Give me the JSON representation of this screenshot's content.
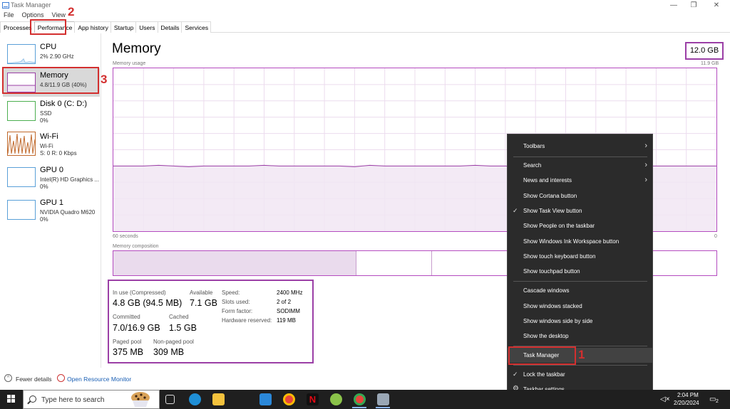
{
  "window": {
    "title": "Task Manager",
    "controls": {
      "minimize": "—",
      "restore": "❐",
      "close": "✕"
    }
  },
  "menu": [
    "File",
    "Options",
    "View"
  ],
  "tabs": [
    "Processes",
    "Performance",
    "App history",
    "Startup",
    "Users",
    "Details",
    "Services"
  ],
  "sidebar": {
    "items": [
      {
        "title": "CPU",
        "line1": "2% 2.90 GHz",
        "line2": "",
        "color": "#5aa0d8"
      },
      {
        "title": "Memory",
        "line1": "4.8/11.9 GB (40%)",
        "line2": "",
        "color": "#9b3fa6"
      },
      {
        "title": "Disk 0 (C: D:)",
        "line1": "SSD",
        "line2": "0%",
        "color": "#4caf50"
      },
      {
        "title": "Wi-Fi",
        "line1": "Wi-Fi",
        "line2": "S: 0 R: 0 Kbps",
        "color": "#c0692c"
      },
      {
        "title": "GPU 0",
        "line1": "Intel(R) HD Graphics ...",
        "line2": "0%",
        "color": "#5aa0d8"
      },
      {
        "title": "GPU 1",
        "line1": "NVIDIA Quadro M620",
        "line2": "0%",
        "color": "#5aa0d8"
      }
    ]
  },
  "main": {
    "title": "Memory",
    "total": "12.0 GB",
    "usage_label": "Memory usage",
    "usage_max": "11.9 GB",
    "time_label": "60 seconds",
    "time_end": "0",
    "composition_label": "Memory composition",
    "usage_level": 0.4
  },
  "stats": {
    "in_use_label": "In use (Compressed)",
    "in_use_value": "4.8 GB (94.5 MB)",
    "available_label": "Available",
    "available_value": "7.1 GB",
    "committed_label": "Committed",
    "committed_value": "7.0/16.9 GB",
    "cached_label": "Cached",
    "cached_value": "1.5 GB",
    "paged_label": "Paged pool",
    "paged_value": "375 MB",
    "nonpaged_label": "Non-paged pool",
    "nonpaged_value": "309 MB",
    "kv": [
      {
        "label": "Speed:",
        "value": "2400 MHz"
      },
      {
        "label": "Slots used:",
        "value": "2 of 2"
      },
      {
        "label": "Form factor:",
        "value": "SODIMM"
      },
      {
        "label": "Hardware reserved:",
        "value": "119 MB"
      }
    ]
  },
  "footer": {
    "fewer_details": "Fewer details",
    "resource_monitor": "Open Resource Monitor"
  },
  "annotations": [
    "1",
    "2",
    "3"
  ],
  "context_menu": {
    "items": [
      {
        "label": "Toolbars",
        "submenu": true,
        "checked": false
      },
      {
        "label": "Search",
        "submenu": true,
        "checked": false
      },
      {
        "label": "News and interests",
        "submenu": true,
        "checked": false
      },
      {
        "label": "Show Cortana button",
        "submenu": false,
        "checked": false
      },
      {
        "label": "Show Task View button",
        "submenu": false,
        "checked": true
      },
      {
        "label": "Show People on the taskbar",
        "submenu": false,
        "checked": false
      },
      {
        "label": "Show Windows Ink Workspace button",
        "submenu": false,
        "checked": false
      },
      {
        "label": "Show touch keyboard button",
        "submenu": false,
        "checked": false
      },
      {
        "label": "Show touchpad button",
        "submenu": false,
        "checked": false
      },
      {
        "label": "Cascade windows",
        "submenu": false,
        "checked": false
      },
      {
        "label": "Show windows stacked",
        "submenu": false,
        "checked": false
      },
      {
        "label": "Show windows side by side",
        "submenu": false,
        "checked": false
      },
      {
        "label": "Show the desktop",
        "submenu": false,
        "checked": false
      },
      {
        "label": "Task Manager",
        "submenu": false,
        "checked": false
      },
      {
        "label": "Lock the taskbar",
        "submenu": false,
        "checked": true
      },
      {
        "label": "Taskbar settings",
        "submenu": false,
        "checked": false
      }
    ]
  },
  "taskbar": {
    "search_placeholder": "Type here to search",
    "time": "2:04 PM",
    "date": "2/20/2024",
    "notifications": "2"
  }
}
